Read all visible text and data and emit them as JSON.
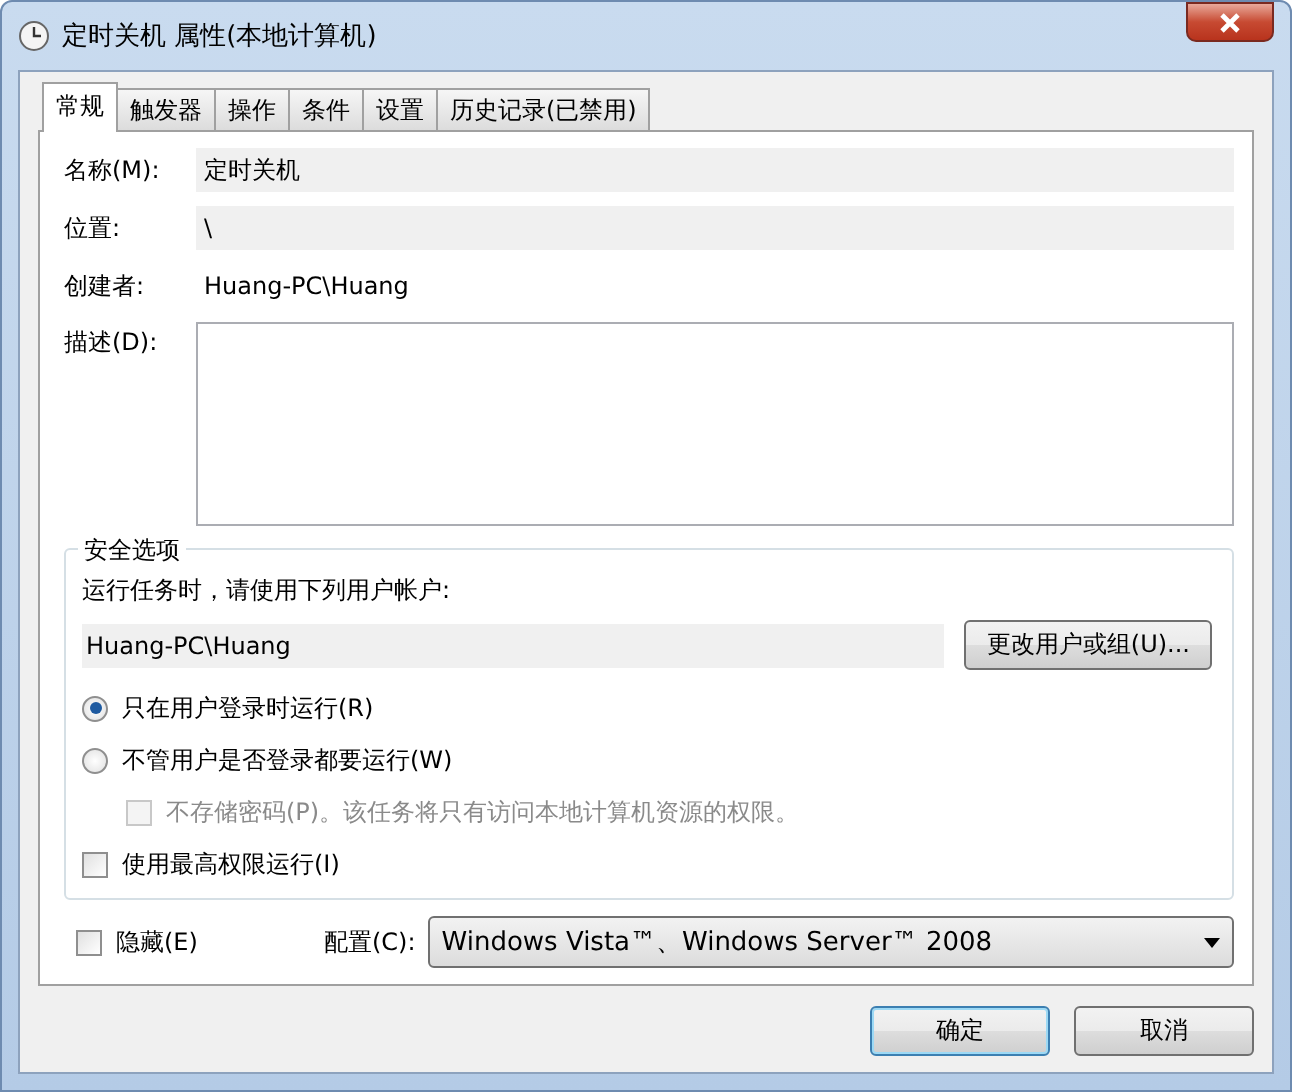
{
  "window": {
    "title": "定时关机 属性(本地计算机)"
  },
  "tabs": [
    {
      "label": "常规",
      "selected": true
    },
    {
      "label": "触发器",
      "selected": false
    },
    {
      "label": "操作",
      "selected": false
    },
    {
      "label": "条件",
      "selected": false
    },
    {
      "label": "设置",
      "selected": false
    },
    {
      "label": "历史记录(已禁用)",
      "selected": false
    }
  ],
  "fields": [
    {
      "kind": "readonly",
      "label": "名称(M):",
      "value": "定时关机"
    },
    {
      "kind": "readonly",
      "label": "位置:",
      "value": "\\"
    },
    {
      "kind": "plain",
      "label": "创建者:",
      "value": "Huang-PC\\Huang"
    },
    {
      "kind": "textarea",
      "label": "描述(D):"
    }
  ],
  "security": {
    "title": "安全选项",
    "prompt": "运行任务时，请使用下列用户帐户:",
    "account": "Huang-PC\\Huang",
    "change_button": "更改用户或组(U)...",
    "options": [
      {
        "kind": "radio",
        "label": "只在用户登录时运行(R)",
        "selected": true
      },
      {
        "kind": "radio",
        "label": "不管用户是否登录都要运行(W)",
        "selected": false,
        "children": [
          {
            "kind": "checkbox",
            "label": "不存储密码(P)。该任务将只有访问本地计算机资源的权限。",
            "checked": false,
            "disabled": true
          }
        ]
      },
      {
        "kind": "checkbox",
        "label": "使用最高权限运行(I)",
        "checked": false,
        "disabled": false
      }
    ]
  },
  "hidden": {
    "label": "隐藏(E)",
    "checked": false
  },
  "config": {
    "label": "配置(C):",
    "value": "Windows Vista™、Windows Server™ 2008"
  },
  "buttons": [
    {
      "label": "确定",
      "default": true
    },
    {
      "label": "取消",
      "default": false
    }
  ]
}
